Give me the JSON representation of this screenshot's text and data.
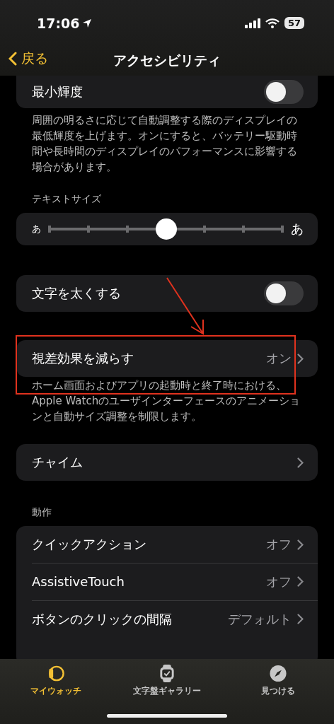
{
  "status_bar": {
    "time": "17:06",
    "battery": "57"
  },
  "nav": {
    "back": "戻る",
    "title": "アクセシビリティ"
  },
  "sections": [
    {
      "rows": [
        {
          "kind": "toggle",
          "label": "最小輝度",
          "on": false
        }
      ],
      "footer": "周囲の明るさに応じて自動調整する際のディスプレイの最低輝度を上げます。オンにすると、バッテリー駆動時間や長時間のディスプレイのパフォーマンスに影響する場合があります。"
    },
    {
      "header": "テキストサイズ",
      "rows": [
        {
          "kind": "slider",
          "min_label": "あ",
          "max_label": "あ",
          "level": 0.5
        }
      ]
    },
    {
      "rows": [
        {
          "kind": "toggle",
          "label": "文字を太くする",
          "on": false
        }
      ]
    },
    {
      "rows": [
        {
          "kind": "link",
          "label": "視差効果を減らす",
          "value": "オン"
        }
      ],
      "footer": "ホーム画面およびアプリの起動時と終了時における、Apple Watchのユーザインターフェースのアニメーションと自動サイズ調整を制限します。"
    },
    {
      "rows": [
        {
          "kind": "link",
          "label": "チャイム"
        }
      ]
    },
    {
      "header": "動作",
      "rows": [
        {
          "kind": "link",
          "label": "クイックアクション",
          "value": "オフ"
        },
        {
          "kind": "link",
          "label": "AssistiveTouch",
          "value": "オフ"
        },
        {
          "kind": "link",
          "label": "ボタンのクリックの間隔",
          "value": "デフォルト"
        }
      ]
    }
  ],
  "tabs": [
    {
      "label": "マイウォッチ",
      "selected": true
    },
    {
      "label": "文字盤ギャラリー",
      "selected": false
    },
    {
      "label": "見つける",
      "selected": false
    }
  ]
}
